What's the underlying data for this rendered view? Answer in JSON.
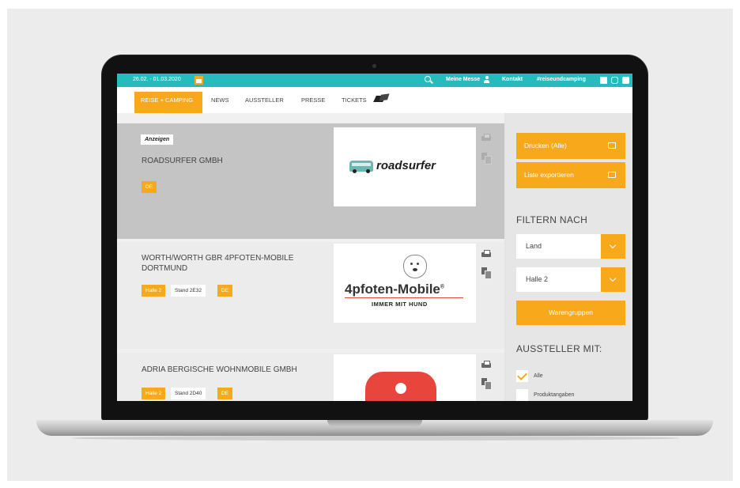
{
  "topbar": {
    "dates": "26.02. - 01.03.2020",
    "my_fair": "Meine Messe",
    "contact": "Kontakt",
    "hashtag": "#reiseundcamping"
  },
  "nav": {
    "items": [
      "REISE + CAMPING",
      "NEWS",
      "AUSSTELLER",
      "PRESSE",
      "TICKETS"
    ]
  },
  "exhibitors": [
    {
      "badge": "Anzeigen",
      "name": "ROADSURFER GMBH",
      "tags": [
        "DE"
      ],
      "logo_text": "roadsurfer"
    },
    {
      "name": "WORTH/WORTH GBR 4PFOTEN-MOBILE DORTMUND",
      "tags": [
        "Halle 2",
        "Stand 2E32",
        "DE"
      ],
      "logo_text": "4pfoten-Mobile",
      "logo_mark": "®",
      "logo_sub": "IMMER MIT HUND"
    },
    {
      "name": "ADRIA BERGISCHE WOHNMOBILE GMBH",
      "tags": [
        "Halle 2",
        "Stand 2D40",
        "DE"
      ]
    }
  ],
  "sidebar": {
    "print_all": "Drucken (Alle)",
    "export_list": "Liste exportieren",
    "filter_heading": "FILTERN NACH",
    "country_select": "Land",
    "hall_select": "Halle 2",
    "product_groups": "Warengruppen",
    "exhibitors_with": "AUSSTELLER MIT:",
    "checks": [
      {
        "label": "Alle",
        "checked": true
      },
      {
        "label": "Produktangaben",
        "checked": false
      }
    ]
  },
  "colors": {
    "teal": "#26bcbd",
    "orange": "#f7a81b"
  }
}
